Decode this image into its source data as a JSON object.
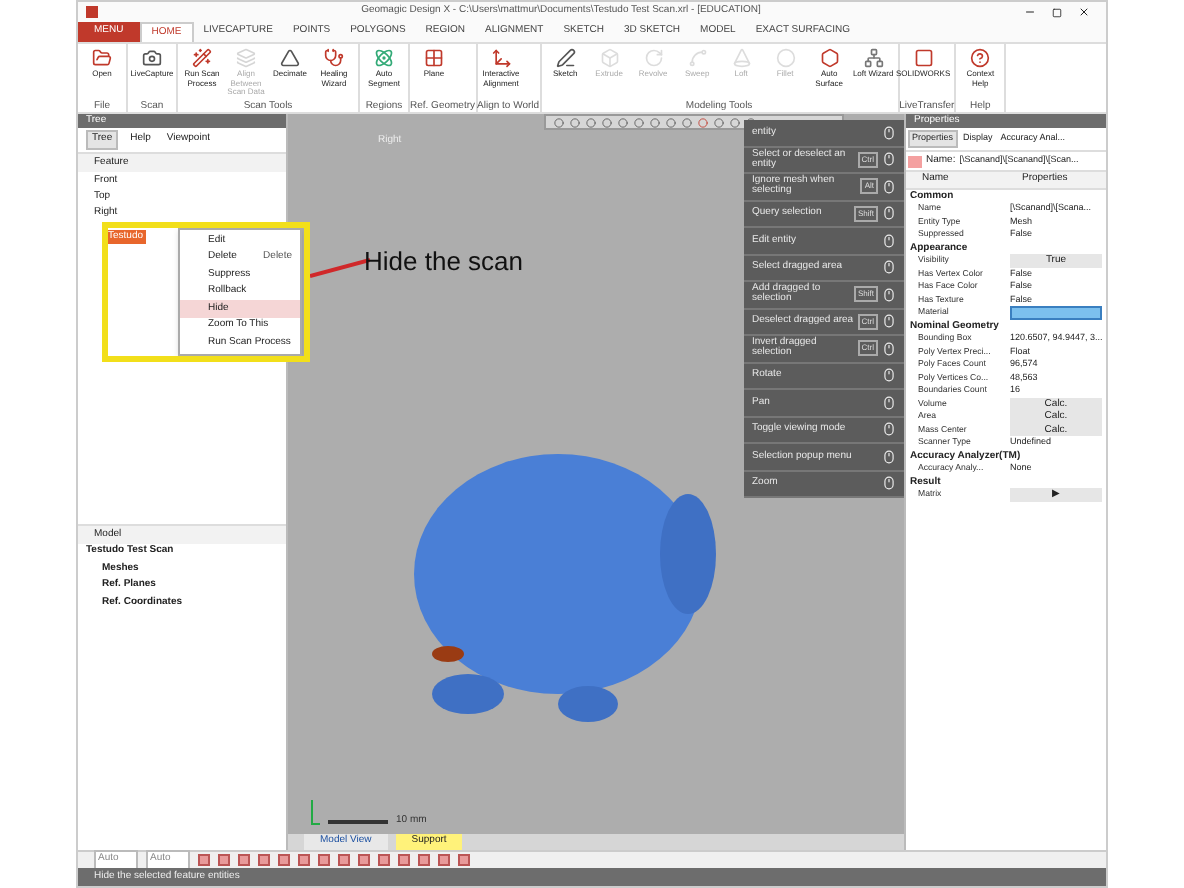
{
  "window": {
    "title": "Geomagic Design X - C:\\Users\\mattmur\\Documents\\Testudo Test Scan.xrl - [EDUCATION]"
  },
  "menu_tabs": [
    {
      "label": "MENU",
      "kind": "menu",
      "selected": false
    },
    {
      "label": "HOME",
      "kind": "tab",
      "selected": true
    },
    {
      "label": "LIVECAPTURE",
      "kind": "tab",
      "selected": false
    },
    {
      "label": "POINTS",
      "kind": "tab",
      "selected": false
    },
    {
      "label": "POLYGONS",
      "kind": "tab",
      "selected": false
    },
    {
      "label": "REGION",
      "kind": "tab",
      "selected": false
    },
    {
      "label": "ALIGNMENT",
      "kind": "tab",
      "selected": false
    },
    {
      "label": "SKETCH",
      "kind": "tab",
      "selected": false
    },
    {
      "label": "3D SKETCH",
      "kind": "tab",
      "selected": false
    },
    {
      "label": "MODEL",
      "kind": "tab",
      "selected": false
    },
    {
      "label": "EXACT SURFACING",
      "kind": "tab",
      "selected": false
    }
  ],
  "ribbon": [
    {
      "label": "File",
      "buttons": [
        {
          "label": "Open",
          "disabled": false
        }
      ]
    },
    {
      "label": "Scan",
      "buttons": [
        {
          "label": "LiveCapture",
          "disabled": false
        }
      ]
    },
    {
      "label": "Scan Tools",
      "buttons": [
        {
          "label": "Run Scan Process",
          "disabled": false
        },
        {
          "label": "Align Between Scan Data",
          "disabled": true
        },
        {
          "label": "Decimate",
          "disabled": false
        },
        {
          "label": "Healing Wizard",
          "disabled": false
        }
      ]
    },
    {
      "label": "Regions",
      "buttons": [
        {
          "label": "Auto Segment",
          "disabled": false
        }
      ]
    },
    {
      "label": "Ref. Geometry",
      "buttons": [
        {
          "label": "Plane",
          "disabled": false
        }
      ]
    },
    {
      "label": "Align to World",
      "buttons": [
        {
          "label": "Interactive Alignment",
          "disabled": false
        }
      ]
    },
    {
      "label": "Modeling Tools",
      "buttons": [
        {
          "label": "Sketch",
          "disabled": false
        },
        {
          "label": "Extrude",
          "disabled": true
        },
        {
          "label": "Revolve",
          "disabled": true
        },
        {
          "label": "Sweep",
          "disabled": true
        },
        {
          "label": "Loft",
          "disabled": true
        },
        {
          "label": "Fillet",
          "disabled": true
        },
        {
          "label": "Auto Surface",
          "disabled": false
        },
        {
          "label": "Loft Wizard",
          "disabled": false
        }
      ]
    },
    {
      "label": "LiveTransfer",
      "buttons": [
        {
          "label": "SOLIDWORKS",
          "disabled": false
        }
      ]
    },
    {
      "label": "Help",
      "buttons": [
        {
          "label": "Context Help",
          "disabled": false
        }
      ]
    }
  ],
  "tree_panel": {
    "title": "Tree",
    "tabs": [
      {
        "label": "Tree",
        "selected": true
      },
      {
        "label": "Help",
        "selected": false
      },
      {
        "label": "Viewpoint",
        "selected": false
      }
    ],
    "header": "Feature",
    "items": [
      {
        "label": "Front",
        "selected": false
      },
      {
        "label": "Top",
        "selected": false
      },
      {
        "label": "Right",
        "selected": false
      },
      {
        "label": "Testudo",
        "selected": true
      }
    ],
    "context_menu": [
      {
        "label": "Edit",
        "selected": false
      },
      {
        "label": "Delete",
        "shortcut": "Delete",
        "selected": false
      },
      {
        "label": "Suppress",
        "selected": false
      },
      {
        "label": "Rollback",
        "selected": false
      },
      {
        "label": "Hide",
        "selected": true
      },
      {
        "label": "Zoom To This",
        "selected": false
      },
      {
        "label": "Run Scan Process",
        "selected": false
      }
    ],
    "model_header": "Model",
    "model_tree": {
      "label": "Testudo Test Scan",
      "children": [
        {
          "label": "Meshes"
        },
        {
          "label": "Ref. Planes"
        },
        {
          "label": "Ref. Coordinates"
        }
      ]
    }
  },
  "annotation": {
    "text": "Hide the scan"
  },
  "viewport": {
    "view_label": "Right",
    "scale_label": "10 mm",
    "mouse_hints": [
      {
        "label": "entity"
      },
      {
        "label": "Select or deselect an entity",
        "key": "Ctrl"
      },
      {
        "label": "Ignore mesh when selecting",
        "key": "Alt"
      },
      {
        "label": "Query selection",
        "key": "Shift"
      },
      {
        "label": "Edit entity"
      },
      {
        "label": "Select dragged area"
      },
      {
        "label": "Add dragged to selection",
        "key": "Shift"
      },
      {
        "label": "Deselect dragged area",
        "key": "Ctrl"
      },
      {
        "label": "Invert dragged selection",
        "key": "Ctrl"
      },
      {
        "label": "Rotate"
      },
      {
        "label": "Pan"
      },
      {
        "label": "Toggle viewing mode"
      },
      {
        "label": "Selection popup menu"
      },
      {
        "label": "Zoom"
      }
    ],
    "tabs": [
      {
        "label": "Model View",
        "selected": false
      },
      {
        "label": "Support",
        "selected": true
      }
    ]
  },
  "bottom_toolbar": {
    "fields": [
      "Auto",
      "Auto"
    ]
  },
  "properties": {
    "title": "Properties",
    "tabs": [
      {
        "label": "Properties",
        "selected": true
      },
      {
        "label": "Display",
        "selected": false
      },
      {
        "label": "Accuracy Anal...",
        "selected": false
      }
    ],
    "name_label": "Name:",
    "name_value": "[\\Scanand]\\[Scanand]\\[Scan...",
    "columns": [
      "Name",
      "Properties"
    ],
    "groups": [
      {
        "label": "Common",
        "rows": [
          {
            "name": "Name",
            "value": "[\\Scanand]\\[Scana...",
            "kind": "text"
          },
          {
            "name": "Entity Type",
            "value": "Mesh",
            "kind": "text"
          },
          {
            "name": "Suppressed",
            "value": "False",
            "kind": "text"
          }
        ]
      },
      {
        "label": "Appearance",
        "rows": [
          {
            "name": "Visibility",
            "value": "True",
            "kind": "button"
          },
          {
            "name": "Has Vertex Color",
            "value": "False",
            "kind": "text"
          },
          {
            "name": "Has Face Color",
            "value": "False",
            "kind": "text"
          },
          {
            "name": "Has Texture",
            "value": "False",
            "kind": "text"
          },
          {
            "name": "Material",
            "kind": "swatch"
          }
        ]
      },
      {
        "label": "Nominal Geometry",
        "rows": [
          {
            "name": "Bounding Box",
            "value": "120.6507, 94.9447, 3...",
            "kind": "text"
          },
          {
            "name": "Poly Vertex Preci...",
            "value": "Float",
            "kind": "text"
          },
          {
            "name": "Poly Faces Count",
            "value": "96,574",
            "kind": "text"
          },
          {
            "name": "Poly Vertices Co...",
            "value": "48,563",
            "kind": "text"
          },
          {
            "name": "Boundaries Count",
            "value": "16",
            "kind": "text"
          },
          {
            "name": "Volume",
            "value": "Calc.",
            "kind": "button"
          },
          {
            "name": "Area",
            "value": "Calc.",
            "kind": "button"
          },
          {
            "name": "Mass Center",
            "value": "Calc.",
            "kind": "button"
          },
          {
            "name": "Scanner Type",
            "value": "Undefined",
            "kind": "text"
          }
        ]
      },
      {
        "label": "Accuracy Analyzer(TM)",
        "rows": [
          {
            "name": "Accuracy Analy...",
            "value": "None",
            "kind": "text"
          }
        ]
      },
      {
        "label": "Result",
        "rows": [
          {
            "name": "Matrix",
            "value": "▶",
            "kind": "button"
          }
        ]
      }
    ]
  },
  "status_bar": {
    "text": "Hide the selected feature entities"
  }
}
